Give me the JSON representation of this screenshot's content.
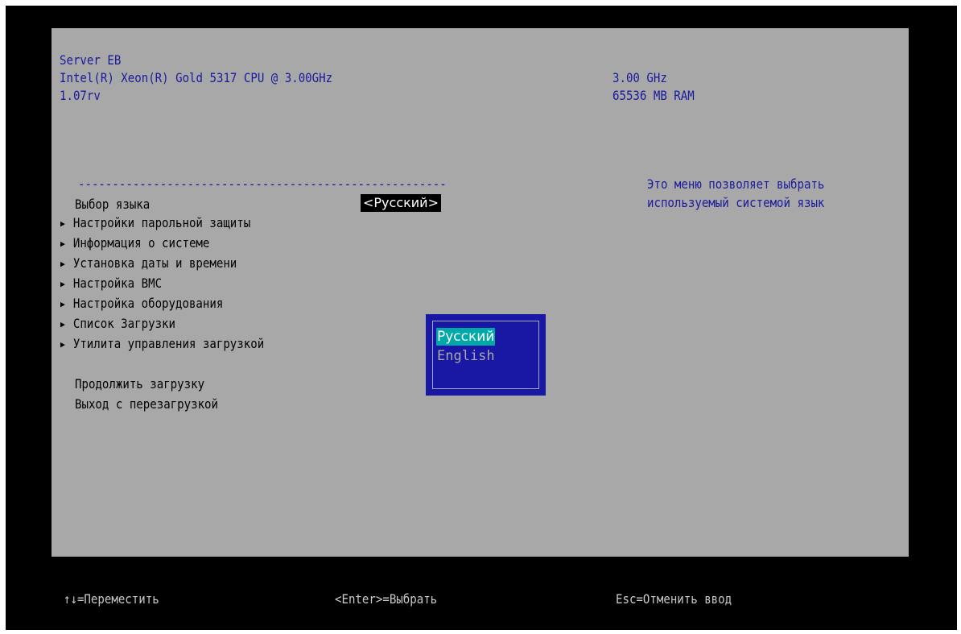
{
  "header": {
    "line1": "Server EB",
    "line2": "Intel(R) Xeon(R) Gold 5317 CPU @ 3.00GHz",
    "line3": "1.07rv",
    "freq": "3.00 GHz",
    "ram": "65536 MB RAM"
  },
  "separator": "------------------------------------------------------",
  "menu": {
    "language_label": "Выбор языка",
    "language_value": "<Русский>",
    "items": [
      "Настройки парольной защиты",
      "Информация о системе",
      "Установка даты и времени",
      "Настройка BMC",
      "Настройка оборудования",
      "Список Загрузки",
      "Утилита управления загрузкой"
    ],
    "continue_boot": "Продолжить загрузку",
    "exit_reboot": "Выход с перезагрузкой"
  },
  "help": {
    "line1": "Это меню позволяет выбрать",
    "line2": "используемый системой язык"
  },
  "popup": {
    "options": [
      "Русский",
      "English"
    ],
    "selected_index": 0
  },
  "footer": {
    "move": "↑↓=Переместить",
    "select": "<Enter>=Выбрать",
    "cancel": "Esc=Отменить ввод"
  },
  "colors": {
    "panel": "#a8a8a8",
    "text_blue": "#1a1a9c",
    "popup_bg": "#1818a4",
    "popup_selected": "#00a8a8"
  }
}
